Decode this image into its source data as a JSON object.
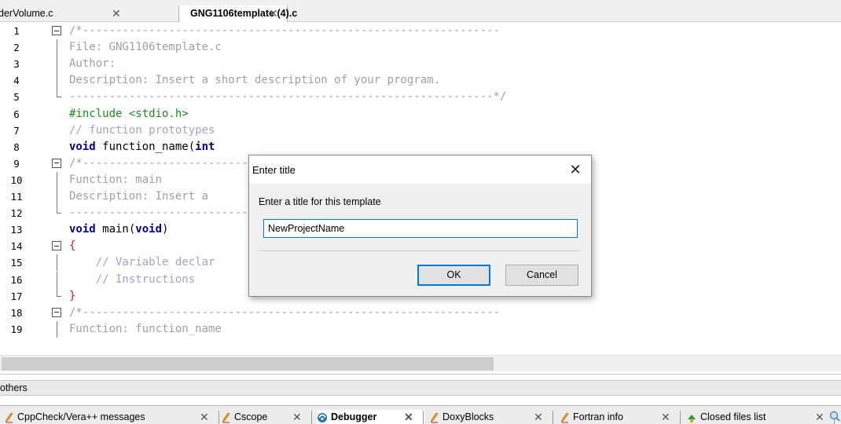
{
  "tabs": [
    {
      "label": "derVolume.c",
      "close": "✕"
    },
    {
      "label": "GNG1106template (4).c",
      "close": "✕"
    }
  ],
  "code_lines": [
    {
      "n": "1",
      "fold": "box",
      "parts": [
        {
          "t": "/*---------------------------------------------------------------",
          "c": "c-comment"
        }
      ]
    },
    {
      "n": "2",
      "fold": "line",
      "parts": [
        {
          "t": "File: GNG1106template.c",
          "c": "c-comment"
        }
      ]
    },
    {
      "n": "3",
      "fold": "line",
      "parts": [
        {
          "t": "Author:",
          "c": "c-comment"
        }
      ]
    },
    {
      "n": "4",
      "fold": "line",
      "parts": [
        {
          "t": "Description: Insert a short description of your program.",
          "c": "c-comment"
        }
      ]
    },
    {
      "n": "5",
      "fold": "end",
      "parts": [
        {
          "t": "----------------------------------------------------------------*/",
          "c": "c-comment"
        }
      ]
    },
    {
      "n": "6",
      "fold": "",
      "parts": [
        {
          "t": "#include <stdio.h>",
          "c": "c-pre"
        }
      ]
    },
    {
      "n": "7",
      "fold": "",
      "parts": [
        {
          "t": "// function prototypes",
          "c": "c-cmt2"
        }
      ]
    },
    {
      "n": "8",
      "fold": "",
      "parts": [
        {
          "t": "void",
          "c": "c-kw"
        },
        {
          "t": " function_name(",
          "c": "c-plain"
        },
        {
          "t": "int",
          "c": "c-kw"
        }
      ]
    },
    {
      "n": "9",
      "fold": "box",
      "parts": [
        {
          "t": "/*---------------------------------------------------------------",
          "c": "c-comment"
        }
      ]
    },
    {
      "n": "10",
      "fold": "line",
      "parts": [
        {
          "t": "Function: main",
          "c": "c-comment"
        }
      ]
    },
    {
      "n": "11",
      "fold": "line",
      "parts": [
        {
          "t": "Description: Insert a                                   ain does.",
          "c": "c-comment"
        }
      ]
    },
    {
      "n": "12",
      "fold": "end",
      "parts": [
        {
          "t": "----------------------------------------------------------------*/",
          "c": "c-comment"
        }
      ]
    },
    {
      "n": "13",
      "fold": "",
      "parts": [
        {
          "t": "void",
          "c": "c-kw"
        },
        {
          "t": " main(",
          "c": "c-plain"
        },
        {
          "t": "void",
          "c": "c-kw"
        },
        {
          "t": ")",
          "c": "c-plain"
        }
      ]
    },
    {
      "n": "14",
      "fold": "box",
      "parts": [
        {
          "t": "{",
          "c": "c-brace"
        }
      ]
    },
    {
      "n": "15",
      "fold": "line",
      "parts": [
        {
          "t": "    // Variable declar",
          "c": "c-cmt2"
        }
      ]
    },
    {
      "n": "16",
      "fold": "line",
      "parts": [
        {
          "t": "    // Instructions",
          "c": "c-cmt2"
        }
      ]
    },
    {
      "n": "17",
      "fold": "end",
      "parts": [
        {
          "t": "}",
          "c": "c-brace"
        }
      ]
    },
    {
      "n": "18",
      "fold": "box",
      "parts": [
        {
          "t": "/*---------------------------------------------------------------",
          "c": "c-comment"
        }
      ]
    },
    {
      "n": "19",
      "fold": "line",
      "parts": [
        {
          "t": "Function: function_name",
          "c": "c-comment"
        }
      ]
    }
  ],
  "bottom_panel": {
    "title": "others",
    "tabs": [
      {
        "label": "CppCheck/Vera++ messages",
        "icon": "pencil-icon"
      },
      {
        "label": "Cscope",
        "icon": "pencil-icon"
      },
      {
        "label": "Debugger",
        "icon": "debugger-icon"
      },
      {
        "label": "DoxyBlocks",
        "icon": "pencil-icon"
      },
      {
        "label": "Fortran info",
        "icon": "pencil-icon"
      },
      {
        "label": "Closed files list",
        "icon": "closed-files-icon"
      }
    ],
    "close": "✕"
  },
  "dialog": {
    "title": "Enter title",
    "close": "✕",
    "prompt": "Enter a title for this template",
    "input_value": "NewProjectName",
    "ok_label": "OK",
    "cancel_label": "Cancel"
  },
  "colors": {
    "accent": "#0078d7",
    "keyword": "#00008b",
    "preprocessor": "#1e8c1e",
    "brace": "#e02020"
  }
}
